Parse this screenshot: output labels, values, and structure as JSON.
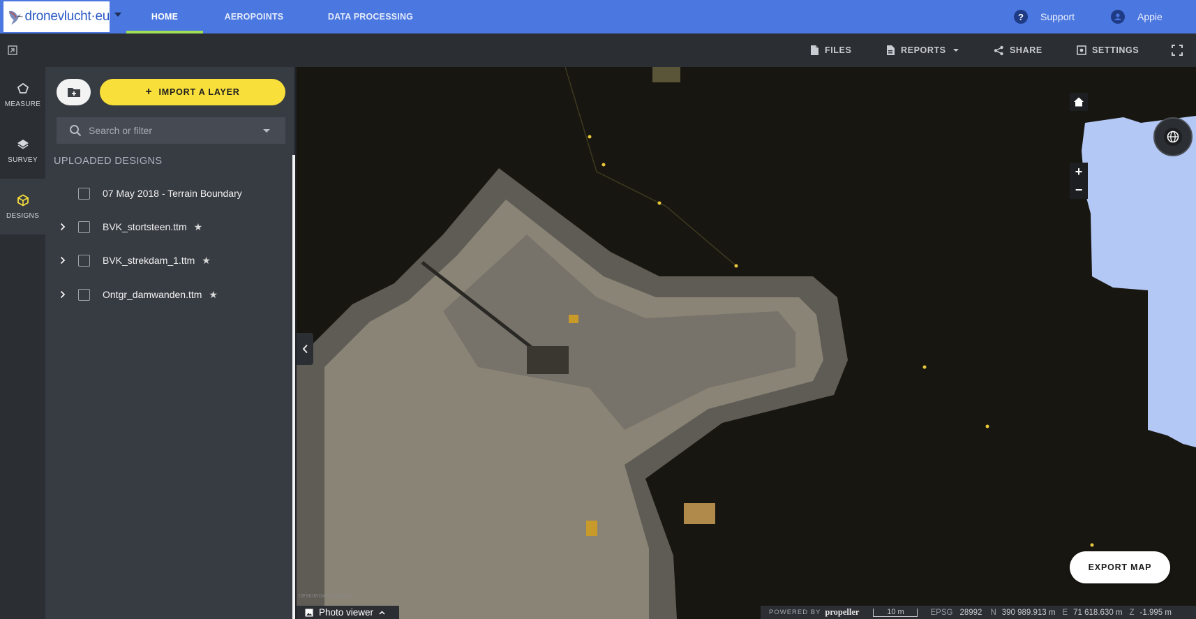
{
  "brand": {
    "logo_text": "dronevlucht·eu"
  },
  "nav": {
    "tabs": [
      {
        "label": "HOME",
        "active": true
      },
      {
        "label": "AEROPOINTS",
        "active": false
      },
      {
        "label": "DATA PROCESSING",
        "active": false
      }
    ],
    "support_label": "Support",
    "user_name": "Appie"
  },
  "toolbar": {
    "files_label": "FILES",
    "reports_label": "REPORTS",
    "share_label": "SHARE",
    "settings_label": "SETTINGS"
  },
  "rail": {
    "items": [
      {
        "label": "MEASURE",
        "icon": "polygon-icon",
        "active": false
      },
      {
        "label": "SURVEY",
        "icon": "layers-icon",
        "active": false
      },
      {
        "label": "DESIGNS",
        "icon": "cube-icon",
        "active": true
      }
    ]
  },
  "panel": {
    "import_label": "IMPORT A LAYER",
    "search_placeholder": "Search or filter",
    "section_title": "UPLOADED DESIGNS",
    "designs": [
      {
        "name": "07 May 2018 - Terrain Boundary",
        "expandable": false,
        "starred": false
      },
      {
        "name": "BVK_stortsteen.ttm",
        "expandable": true,
        "starred": true
      },
      {
        "name": "BVK_strekdam_1.ttm",
        "expandable": true,
        "starred": true
      },
      {
        "name": "Ontgr_damwanden.ttm",
        "expandable": true,
        "starred": true
      }
    ]
  },
  "map": {
    "export_label": "EXPORT MAP",
    "photo_viewer_label": "Photo viewer",
    "attribution": "CESIUM  Data attribution",
    "powered_by": "POWERED BY",
    "powered_brand": "propeller",
    "scale_label": "10 m",
    "crs_label": "EPSG",
    "crs_code": "28992",
    "north_label": "N",
    "north_value": "390 989.913 m",
    "east_label": "E",
    "east_value": "71 618.630 m",
    "z_label": "Z",
    "z_value": "-1.995 m"
  },
  "colors": {
    "topbar": "#4a77e0",
    "active_tab_underline": "#9fe056",
    "import_button": "#f8df3a",
    "active_rail_icon": "#f8df3a",
    "water_overlay": "#b4c8f5"
  }
}
